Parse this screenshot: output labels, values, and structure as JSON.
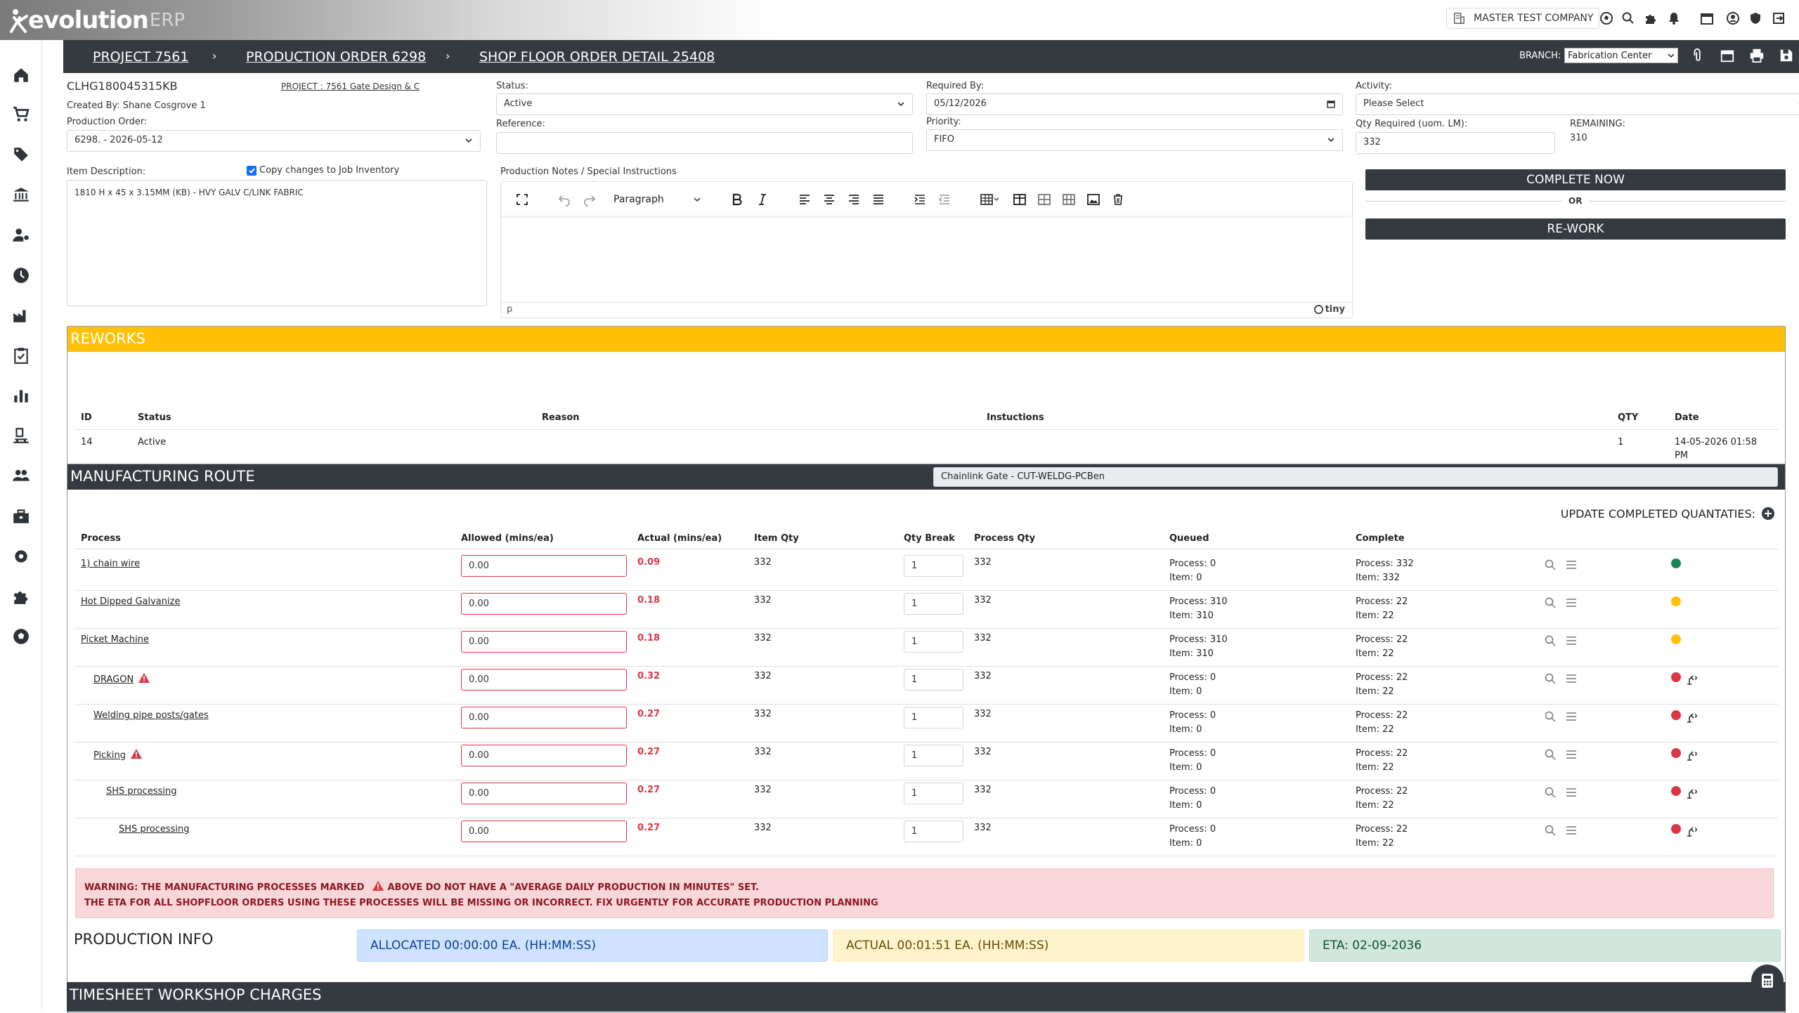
{
  "topbar": {
    "logo_main": "evolution",
    "logo_suffix": "ERP",
    "company_name": "MASTER TEST COMPANY",
    "icons": [
      "soccer-ball-icon",
      "search-icon",
      "puzzle-icon",
      "bell-icon",
      "calendar-icon",
      "user-circle-icon",
      "shield-icon",
      "logout-icon"
    ]
  },
  "sidebar": {
    "items": [
      "home-icon",
      "cart-icon",
      "tag-icon",
      "bank-icon",
      "user-settings-icon",
      "clock-icon",
      "factory-icon",
      "clipboard-check-icon",
      "bar-chart-icon",
      "delivery-icon",
      "users-icon",
      "toolbox-icon",
      "gear-icon",
      "puzzle-icon",
      "soccer-ball-icon"
    ]
  },
  "breadcrumb": {
    "items": [
      "PROJECT 7561",
      "PRODUCTION ORDER 6298",
      "SHOP FLOOR ORDER DETAIL 25408"
    ],
    "separator": "›",
    "branch_label": "BRANCH:",
    "branch_value": "Fabrication Center"
  },
  "order": {
    "code": "CLHG180045315KB",
    "project_ref": "PROJECT : 7561  Gate Design & C",
    "created_by": "Created By: Shane Cosgrove 1",
    "production_order_label": "Production Order:",
    "production_order_value": "6298. - 2026-05-12",
    "status_label": "Status:",
    "status_value": "Active",
    "reference_label": "Reference:",
    "reference_value": "",
    "required_by_label": "Required By:",
    "required_by_value": "05/12/2026",
    "priority_label": "Priority:",
    "priority_value": "FIFO",
    "activity_label": "Activity:",
    "activity_value": "Please Select",
    "qty_required_label": "Qty Required (uom. LM):",
    "qty_required_value": "332",
    "remaining_label": "REMAINING:",
    "remaining_value": "310",
    "item_description_label": "Item Description:",
    "copy_changes_label": "Copy changes to Job Inventory",
    "item_description_value": "1810 H x 45 x 3.15MM (KB) - HVY GALV C/LINK FABRIC",
    "notes_label": "Production Notes / Special Instructions",
    "editor_block_format": "Paragraph",
    "editor_status_path": "p",
    "editor_brand": "tiny",
    "complete_now": "COMPLETE NOW",
    "or_text": "OR",
    "rework": "RE-WORK"
  },
  "reworks": {
    "title": "REWORKS",
    "headers": [
      "ID",
      "Status",
      "Reason",
      "Instuctions",
      "QTY",
      "Date"
    ],
    "rows": [
      {
        "id": "14",
        "status": "Active",
        "reason": "",
        "instructions": "",
        "qty": "1",
        "date_line1": "14-05-2026 01:58",
        "date_line2": "PM"
      }
    ]
  },
  "route": {
    "title": "MANUFACTURING ROUTE",
    "route_name": "Chainlink Gate - CUT-WELDG-PCBen",
    "update_label": "UPDATE COMPLETED QUANTATIES:",
    "headers": [
      "Process",
      "Allowed (mins/ea)",
      "Actual (mins/ea)",
      "Item Qty",
      "Qty Break",
      "Process Qty",
      "Queued",
      "Complete"
    ],
    "rows": [
      {
        "process": "1) chain wire",
        "indent": 0,
        "warn": false,
        "allowed": "0.00",
        "actual": "0.09",
        "item_qty": "332",
        "qty_break": "1",
        "process_qty": "332",
        "queued_process": "Process: 0",
        "queued_item": "Item: 0",
        "complete_process": "Process: 332",
        "complete_item": "Item: 332",
        "status": "#198754",
        "extra_icon": false
      },
      {
        "process": "Hot Dipped Galvanize",
        "indent": 0,
        "warn": false,
        "allowed": "0.00",
        "actual": "0.18",
        "item_qty": "332",
        "qty_break": "1",
        "process_qty": "332",
        "queued_process": "Process: 310",
        "queued_item": "Item: 310",
        "complete_process": "Process: 22",
        "complete_item": "Item: 22",
        "status": "#ffc107",
        "extra_icon": false
      },
      {
        "process": "Picket Machine",
        "indent": 0,
        "warn": false,
        "allowed": "0.00",
        "actual": "0.18",
        "item_qty": "332",
        "qty_break": "1",
        "process_qty": "332",
        "queued_process": "Process: 310",
        "queued_item": "Item: 310",
        "complete_process": "Process: 22",
        "complete_item": "Item: 22",
        "status": "#ffc107",
        "extra_icon": false
      },
      {
        "process": "DRAGON",
        "indent": 1,
        "warn": true,
        "allowed": "0.00",
        "actual": "0.32",
        "item_qty": "332",
        "qty_break": "1",
        "process_qty": "332",
        "queued_process": "Process: 0",
        "queued_item": "Item: 0",
        "complete_process": "Process: 22",
        "complete_item": "Item: 22",
        "status": "#dc3545",
        "extra_icon": true
      },
      {
        "process": "Welding pipe posts/gates",
        "indent": 1,
        "warn": false,
        "allowed": "0.00",
        "actual": "0.27",
        "item_qty": "332",
        "qty_break": "1",
        "process_qty": "332",
        "queued_process": "Process: 0",
        "queued_item": "Item: 0",
        "complete_process": "Process: 22",
        "complete_item": "Item: 22",
        "status": "#dc3545",
        "extra_icon": true
      },
      {
        "process": "Picking",
        "indent": 1,
        "warn": true,
        "allowed": "0.00",
        "actual": "0.27",
        "item_qty": "332",
        "qty_break": "1",
        "process_qty": "332",
        "queued_process": "Process: 0",
        "queued_item": "Item: 0",
        "complete_process": "Process: 22",
        "complete_item": "Item: 22",
        "status": "#dc3545",
        "extra_icon": true
      },
      {
        "process": "SHS processing",
        "indent": 2,
        "warn": false,
        "allowed": "0.00",
        "actual": "0.27",
        "item_qty": "332",
        "qty_break": "1",
        "process_qty": "332",
        "queued_process": "Process: 0",
        "queued_item": "Item: 0",
        "complete_process": "Process: 22",
        "complete_item": "Item: 22",
        "status": "#dc3545",
        "extra_icon": true
      },
      {
        "process": "SHS processing",
        "indent": 3,
        "warn": false,
        "allowed": "0.00",
        "actual": "0.27",
        "item_qty": "332",
        "qty_break": "1",
        "process_qty": "332",
        "queued_process": "Process: 0",
        "queued_item": "Item: 0",
        "complete_process": "Process: 22",
        "complete_item": "Item: 22",
        "status": "#dc3545",
        "extra_icon": true
      }
    ],
    "warning_line1_a": "WARNING: THE MANUFACTURING PROCESSES MARKED",
    "warning_line1_b": "ABOVE DO NOT HAVE A \"AVERAGE DAILY PRODUCTION IN MINUTES\" SET.",
    "warning_line2": "THE ETA FOR ALL SHOPFLOOR ORDERS USING THESE PROCESSES WILL BE MISSING OR INCORRECT. FIX URGENTLY FOR ACCURATE PRODUCTION PLANNING"
  },
  "production_info": {
    "title": "PRODUCTION INFO",
    "allocated": "ALLOCATED 00:00:00 EA. (HH:MM:SS)",
    "actual": "ACTUAL 00:01:51 EA. (HH:MM:SS)",
    "eta": "ETA: 02-09-2036"
  },
  "timesheet": {
    "title": "TIMESHEET WORKSHOP CHARGES"
  },
  "colors": {
    "dark": "#343a40",
    "reworks_header": "#ffc107",
    "danger": "#dc3545",
    "success": "#198754",
    "warning": "#ffc107",
    "info_blue": "#cfe2ff",
    "info_yellow": "#fff3cd",
    "info_green": "#d1e7dd"
  }
}
